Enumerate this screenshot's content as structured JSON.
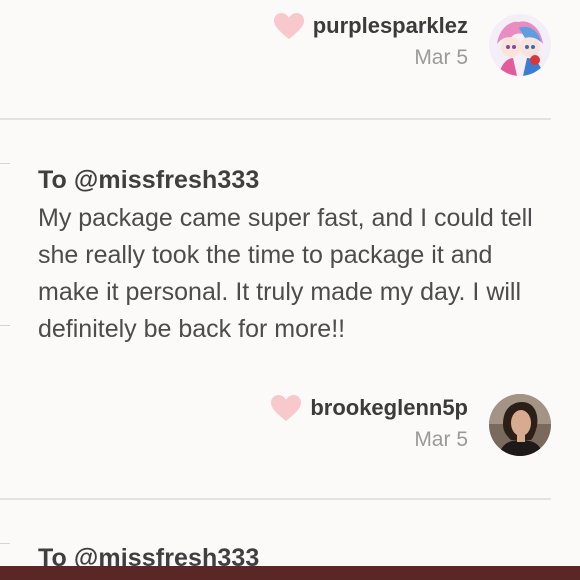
{
  "reviews": [
    {
      "to": "",
      "text": "",
      "username": "purplesparklez",
      "date": "Mar 5",
      "avatar_icon": "anime-avatar-icon"
    },
    {
      "to": "To @missfresh333",
      "text": "My package came super fast, and I could tell she really took the time to package it and make it personal. It truly made my day. I will definitely be back for more!!",
      "username": "brookeglenn5p",
      "date": "Mar 5",
      "avatar_icon": "user-photo-avatar-icon"
    },
    {
      "to": "To @missfresh333",
      "text": "",
      "username": "",
      "date": ""
    }
  ],
  "colors": {
    "heart": "#f7c9cc",
    "bottom_bar": "#5a2626",
    "background": "#fcf9f9"
  }
}
